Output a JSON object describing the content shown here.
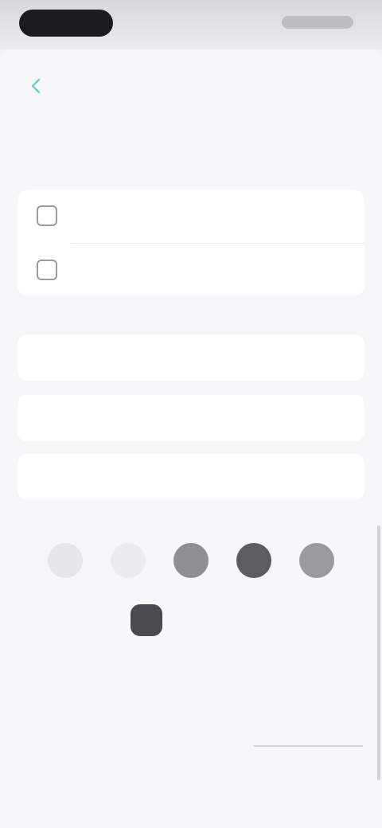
{
  "status_bar": {
    "time": "",
    "indicators": ""
  },
  "nav": {
    "title": "",
    "back_icon": "back-icon"
  },
  "section": {
    "label": ""
  },
  "options": [
    {
      "label": "",
      "icon": "square-icon"
    },
    {
      "label": "",
      "icon": "square-icon"
    }
  ],
  "actions": [
    {
      "label": ""
    },
    {
      "label": ""
    },
    {
      "label": ""
    }
  ],
  "social_icons": [
    {
      "icon": "circle-outline-icon",
      "color": "#e6e6ea"
    },
    {
      "icon": "small-icon",
      "color": "#e9e9ed"
    },
    {
      "icon": "circle-filled-icon",
      "color": "#8e8e94"
    },
    {
      "icon": "circle-filled-icon",
      "color": "#5c5c62"
    },
    {
      "icon": "circle-filled-icon",
      "color": "#9a9aa0"
    }
  ],
  "brand": {
    "name": "",
    "subtitle": ""
  },
  "footer": {
    "left_text": "",
    "right_text": ""
  },
  "colors": {
    "background": "#f4f4f8",
    "card": "#ffffff",
    "status_pill": "#1c1c1e"
  }
}
